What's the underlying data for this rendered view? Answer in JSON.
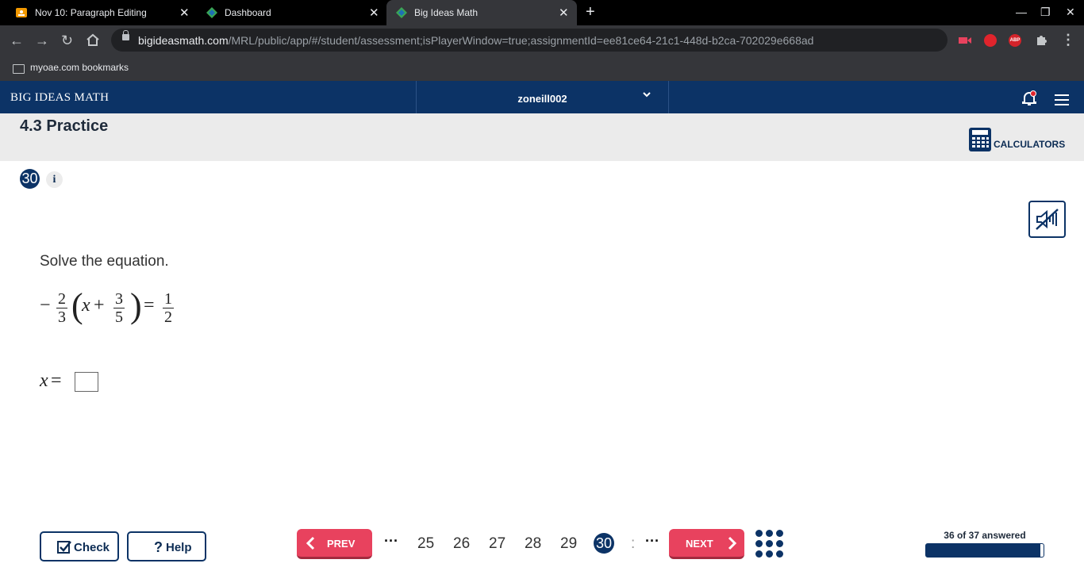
{
  "browser": {
    "tabs": [
      {
        "title": "Nov 10: Paragraph Editing",
        "icon": "slides-icon",
        "active": false
      },
      {
        "title": "Dashboard",
        "icon": "bim-logo-icon",
        "active": false
      },
      {
        "title": "Big Ideas Math",
        "icon": "bim-logo-icon",
        "active": true
      }
    ],
    "url_host": "bigideasmath.com",
    "url_path": "/MRL/public/app/#/student/assessment;isPlayerWindow=true;assignmentId=ee81ce64-21c1-448d-b2ca-702029e668ad",
    "bookmark": "myoae.com bookmarks",
    "extensions": [
      "video-ext-icon",
      "stop-hand-icon",
      "adblock-plus-icon",
      "puzzle-extensions-icon"
    ],
    "abp_label": "ABP"
  },
  "app": {
    "brand": "BIG IDEAS MATH",
    "username": "zoneill002"
  },
  "practice": {
    "title": "4.3 Practice",
    "calculators_label": "CALCULATORS"
  },
  "question": {
    "number": "30",
    "info": "i",
    "prompt": "Solve the equation.",
    "equation": {
      "sign": "−",
      "coef_num": "2",
      "coef_den": "3",
      "lparen": "(",
      "var": "x",
      "plus": "+",
      "inner_num": "3",
      "inner_den": "5",
      "rparen": ")",
      "eq": "=",
      "rhs_num": "1",
      "rhs_den": "2"
    },
    "answer_label_var": "x",
    "answer_label_eq": "=",
    "answer_value": ""
  },
  "footer": {
    "check_label": "Check",
    "help_label": "Help",
    "prev_label": "PREV",
    "next_label": "NEXT",
    "ellipsis": "···",
    "pages": [
      "25",
      "26",
      "27",
      "28",
      "29"
    ],
    "current_page": "30",
    "clipped_page": ":",
    "answered_label": "36 of 37 answered",
    "answered_fraction": 0.973
  }
}
